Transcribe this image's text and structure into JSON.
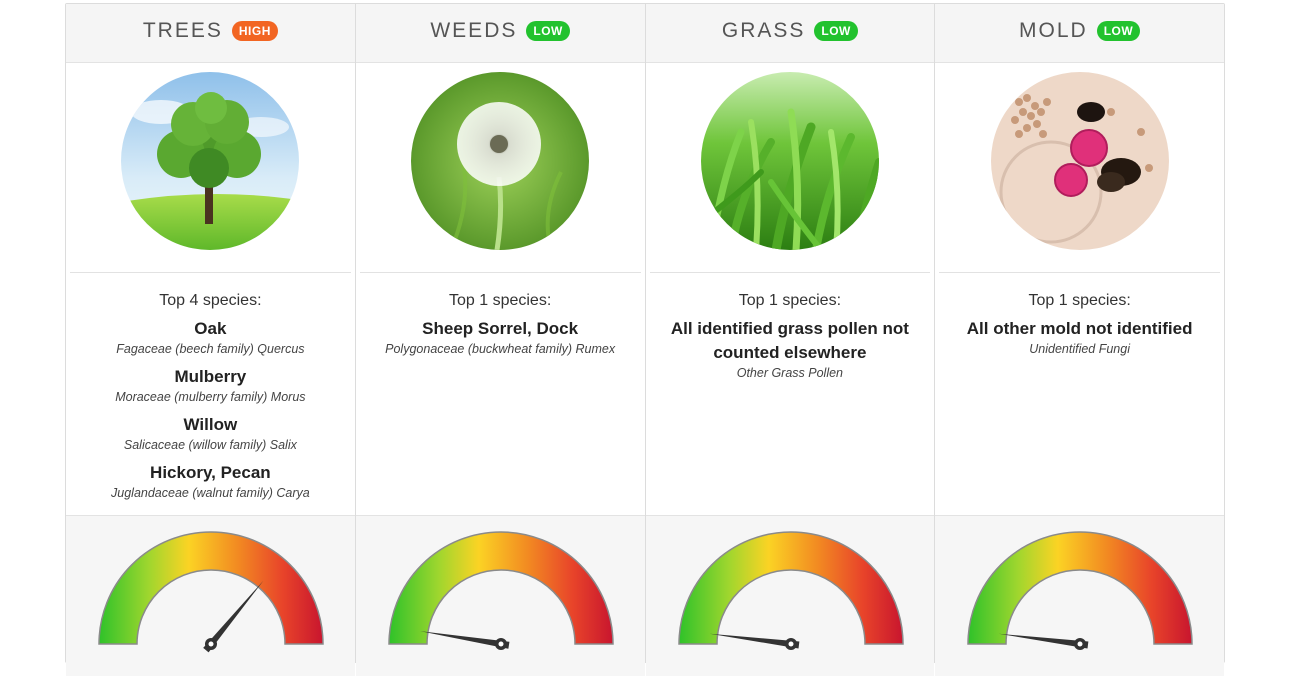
{
  "columns": [
    {
      "title": "TREES",
      "level": "HIGH",
      "level_color": "#f26522",
      "image": "tree-photo",
      "top_label": "Top 4 species:",
      "gauge_value": 0.72,
      "species": [
        {
          "name": "Oak",
          "sub": "Fagaceae (beech family) Quercus"
        },
        {
          "name": "Mulberry",
          "sub": "Moraceae (mulberry family) Morus"
        },
        {
          "name": "Willow",
          "sub": "Salicaceae (willow family) Salix"
        },
        {
          "name": "Hickory, Pecan",
          "sub": "Juglandaceae (walnut family) Carya"
        }
      ]
    },
    {
      "title": "WEEDS",
      "level": "LOW",
      "level_color": "#22c22e",
      "image": "dandelion-photo",
      "top_label": "Top 1 species:",
      "gauge_value": 0.05,
      "species": [
        {
          "name": "Sheep Sorrel, Dock",
          "sub": "Polygonaceae (buckwheat family) Rumex"
        }
      ]
    },
    {
      "title": "GRASS",
      "level": "LOW",
      "level_color": "#22c22e",
      "image": "grass-photo",
      "top_label": "Top 1 species:",
      "gauge_value": 0.04,
      "species": [
        {
          "name": "All identified grass pollen not counted elsewhere",
          "sub": "Other Grass Pollen"
        }
      ]
    },
    {
      "title": "MOLD",
      "level": "LOW",
      "level_color": "#22c22e",
      "image": "mold-microscope-photo",
      "top_label": "Top 1 species:",
      "gauge_value": 0.04,
      "species": [
        {
          "name": "All other mold not identified",
          "sub": "Unidentified Fungi"
        }
      ]
    }
  ]
}
